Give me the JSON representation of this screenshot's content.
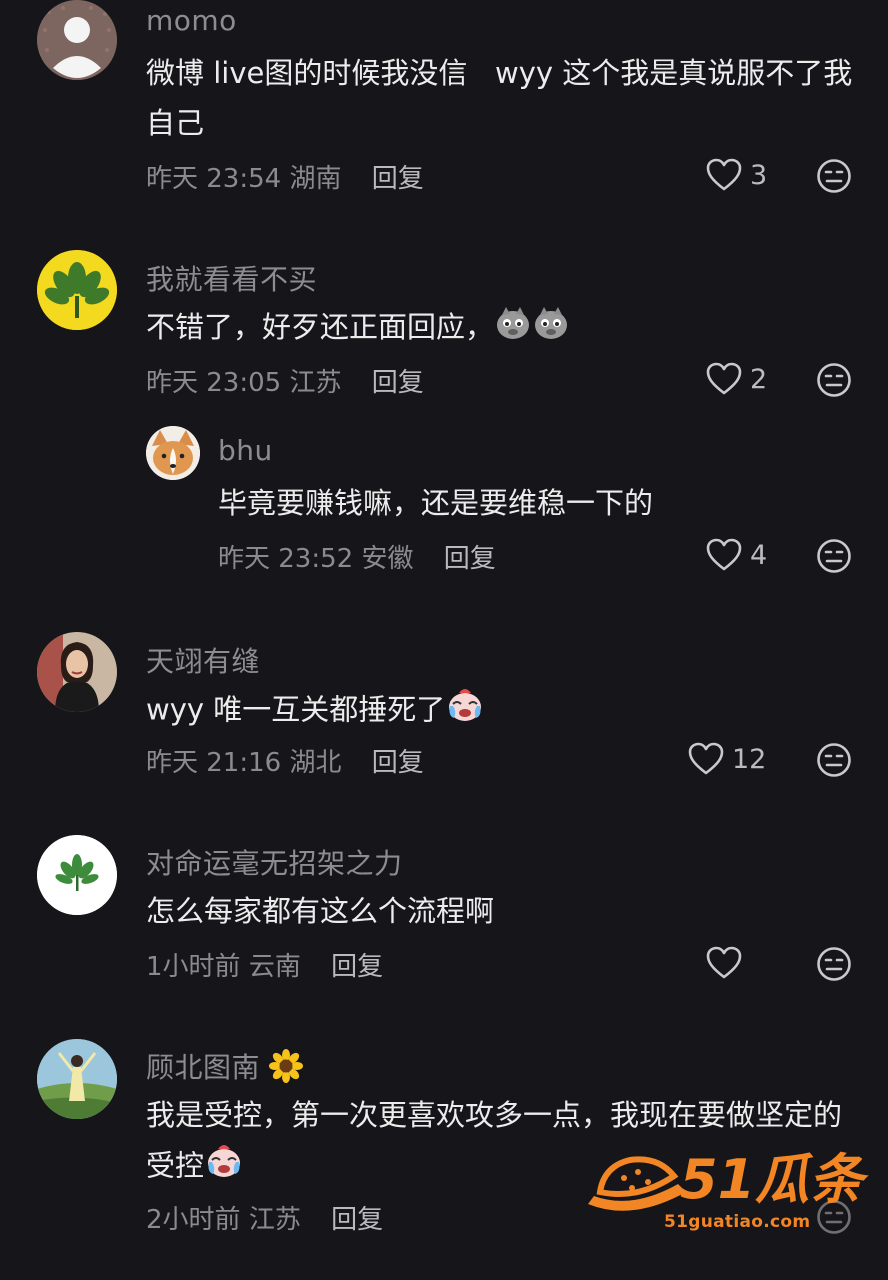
{
  "comments": [
    {
      "username": "momo",
      "text": "微博 live图的时候我没信   wyy 这个我是真说服不了我自己",
      "time": "昨天 23:54",
      "location": "湖南",
      "reply_label": "回复",
      "likes": "3",
      "avatar_icon": "default-user-icon"
    },
    {
      "username": "我就看看不买",
      "text": "不错了，好歹还正面回应，",
      "emoji": [
        "doge-emoji",
        "doge-emoji"
      ],
      "time": "昨天 23:05",
      "location": "江苏",
      "reply_label": "回复",
      "likes": "2",
      "avatar_icon": "plant-icon",
      "replies": [
        {
          "username": "bhu",
          "text": "毕竟要赚钱嘛，还是要维稳一下的",
          "time": "昨天 23:52",
          "location": "安徽",
          "reply_label": "回复",
          "likes": "4",
          "avatar_icon": "corgi-icon"
        }
      ]
    },
    {
      "username": "天翊有缝",
      "text": "wyy 唯一互关都捶死了",
      "emoji": [
        "crying-emoji"
      ],
      "time": "昨天 21:16",
      "location": "湖北",
      "reply_label": "回复",
      "likes": "12",
      "avatar_icon": "portrait-photo"
    },
    {
      "username": "对命运毫无招架之力",
      "text": "怎么每家都有这么个流程啊",
      "time": "1小时前",
      "location": "云南",
      "reply_label": "回复",
      "likes": "",
      "avatar_icon": "leaf-icon"
    },
    {
      "username": "顾北图南",
      "username_emoji": "sunflower-emoji",
      "text": "我是受控，第一次更喜欢攻多一点，我现在要做坚定的受控",
      "emoji": [
        "crying-emoji"
      ],
      "time": "2小时前",
      "location": "江苏",
      "reply_label": "回复",
      "likes": "",
      "avatar_icon": "landscape-photo"
    }
  ],
  "watermark": {
    "brand": "51瓜条",
    "domain": "51guatiao.com"
  },
  "colors": {
    "background": "#16161a",
    "text": "#ececec",
    "meta": "#8a8a90",
    "accent": "#f28524"
  }
}
